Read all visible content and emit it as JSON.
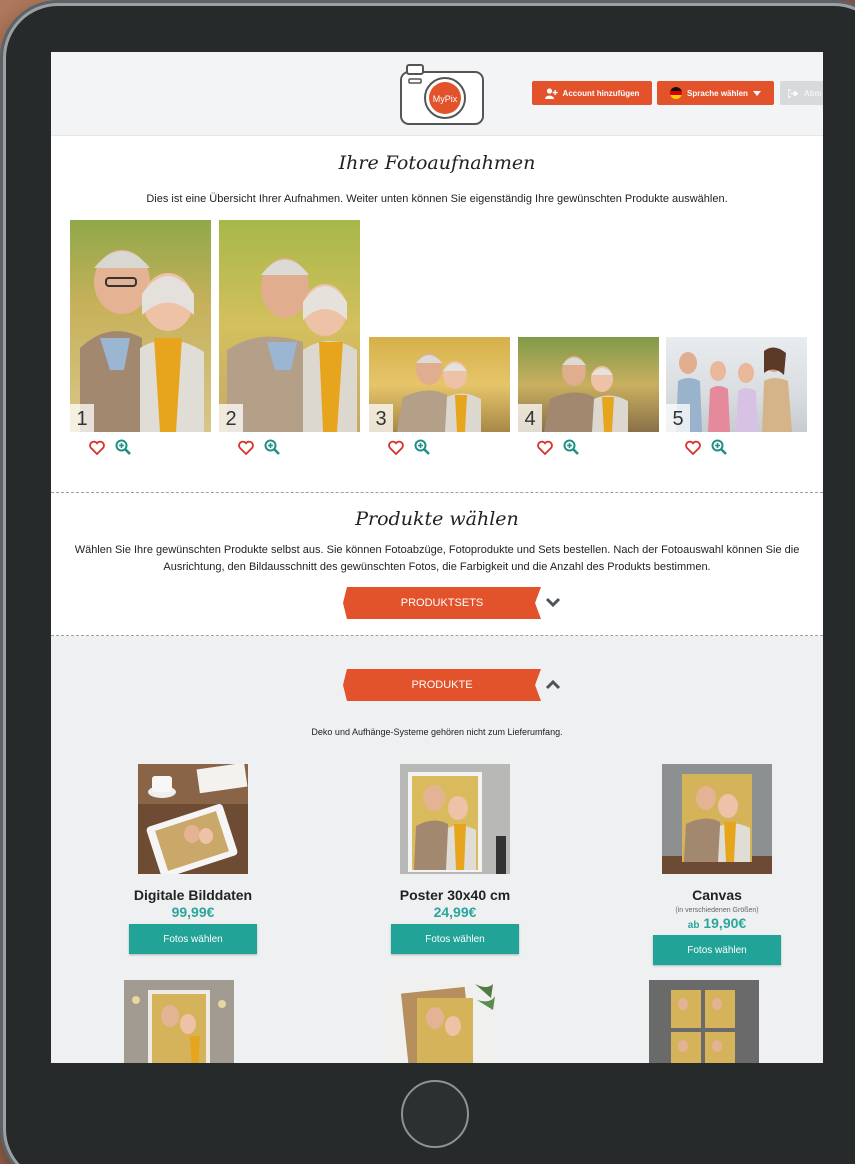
{
  "header": {
    "logo_text": "MyPix",
    "account_button": "Account hinzufügen",
    "language_button": "Sprache wählen",
    "logout_button": "Abm"
  },
  "photos_section": {
    "title": "Ihre Fotoaufnahmen",
    "intro": "Dies ist eine Übersicht Ihrer Aufnahmen. Weiter unten können Sie eigenständig Ihre gewünschten Produkte auswählen.",
    "photos": [
      {
        "number": "1"
      },
      {
        "number": "2"
      },
      {
        "number": "3"
      },
      {
        "number": "4"
      },
      {
        "number": "5"
      }
    ]
  },
  "products_section": {
    "title": "Produkte wählen",
    "intro_line1": "Wählen Sie Ihre gewünschten Produkte selbst aus. Sie können Fotoabzüge, Fotoprodukte und Sets bestellen. Nach der Fotoauswahl können Sie die",
    "intro_line2": "Ausrichtung, den Bildausschnitt des gewünschten Fotos, die Farbigkeit und die Anzahl des Produkts bestimmen.",
    "sets_ribbon": "PRODUKTSETS",
    "products_ribbon": "PRODUKTE",
    "deco_note": "Deko und Aufhänge-Systeme gehören nicht zum Lieferumfang.",
    "items": [
      {
        "name": "Digitale Bilddaten",
        "price": "99,99€",
        "button": "Fotos wählen"
      },
      {
        "name": "Poster 30x40 cm",
        "price": "24,99€",
        "button": "Fotos wählen"
      },
      {
        "name": "Canvas",
        "subtitle": "(in verschiedenen Größen)",
        "price_prefix": "ab",
        "price": "19,90€",
        "button": "Fotos wählen"
      }
    ]
  },
  "colors": {
    "accent": "#e2532c",
    "teal": "#21a398",
    "price": "#2aa69a"
  }
}
